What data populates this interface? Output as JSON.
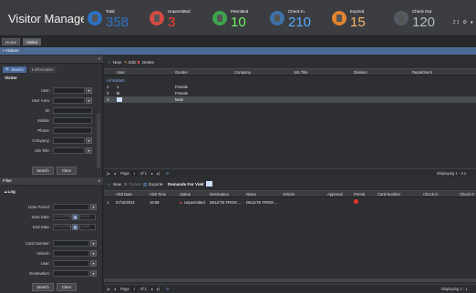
{
  "app": {
    "title": "Visitor Management"
  },
  "stats": [
    {
      "label": "Total",
      "value": "358",
      "bg": "#2d71c6",
      "color": "#2d71c6",
      "fg": "#2d71c6"
    },
    {
      "label": "Unpermitted",
      "value": "3",
      "bg": "#d54b43",
      "color": "#ff3b30"
    },
    {
      "label": "Permitted",
      "value": "10",
      "bg": "#3ca64d",
      "color": "#6ef061"
    },
    {
      "label": "Check In",
      "value": "210",
      "bg": "#3d73a8",
      "color": "#56a9ff"
    },
    {
      "label": "Expired",
      "value": "15",
      "bg": "#e1832f",
      "color": "#ffb266"
    },
    {
      "label": "Check Out",
      "value": "120",
      "bg": "#545a62",
      "color": "#b6bcc4"
    }
  ],
  "header_icons": "21 ⚙ ●",
  "tabs": [
    "Home",
    "Visitor"
  ],
  "visitors_bar": "Visitors",
  "filter_bar": "Filter",
  "search_panel": {
    "tabs": [
      "Search",
      "Information"
    ],
    "legend": "Visitor",
    "fields": [
      "User:",
      "User Area:",
      "ID:",
      "Mobile:",
      "Phone:",
      "Company:",
      "Job Title:"
    ],
    "search_button": "Search",
    "clear_button": "Clear"
  },
  "filter_panel": {
    "legend": "Log",
    "date_period_label": "Date Period:",
    "start_label": "Start Date:",
    "start_value": "07/01/2021",
    "start_time": "00:00",
    "end_label": "End Date:",
    "end_value": "07/31/2021",
    "end_time": "23:59",
    "fields": [
      "Card Number:",
      "Vehicle:",
      "User:",
      "Destination:"
    ],
    "search_button": "Search",
    "clear_button": "Clear"
  },
  "visitors_grid": {
    "toolbar": {
      "new": "New",
      "edit": "Edit",
      "delete": "Delete"
    },
    "columns": [
      "User",
      "Gender",
      "Company",
      "Job Title",
      "Division",
      "Department"
    ],
    "group_label": "All Visitors",
    "rows": [
      {
        "num": "1",
        "user": "1",
        "gender": "Female"
      },
      {
        "num": "2",
        "user": "D",
        "gender": "Female"
      },
      {
        "num": "3",
        "user": "",
        "gender": "Male"
      }
    ],
    "pager": {
      "page_label": "Page",
      "page_value": "1",
      "of_label": "of 1",
      "display": "Displaying 1 - 3 o"
    }
  },
  "demands_grid": {
    "toolbar": {
      "new": "New",
      "delete": "Delete",
      "export": "Export",
      "demands": "Demands For Visit"
    },
    "columns": [
      "Visit Date",
      "Visit Time",
      "Status",
      "Destination",
      "Notes",
      "Vehicle",
      "Approval",
      "Permit",
      "Card Number",
      "Check In",
      "Check O"
    ],
    "rows": [
      {
        "num": "1",
        "date": "07/16/2021",
        "time": "16:59",
        "status": "Unpermitted",
        "destination": "DELETE FROM ...",
        "notes": "DELETE FROM ..."
      }
    ],
    "pager": {
      "page_label": "Page",
      "page_value": "1",
      "of_label": "of 1",
      "display": "Displaying 1 - 1"
    }
  }
}
